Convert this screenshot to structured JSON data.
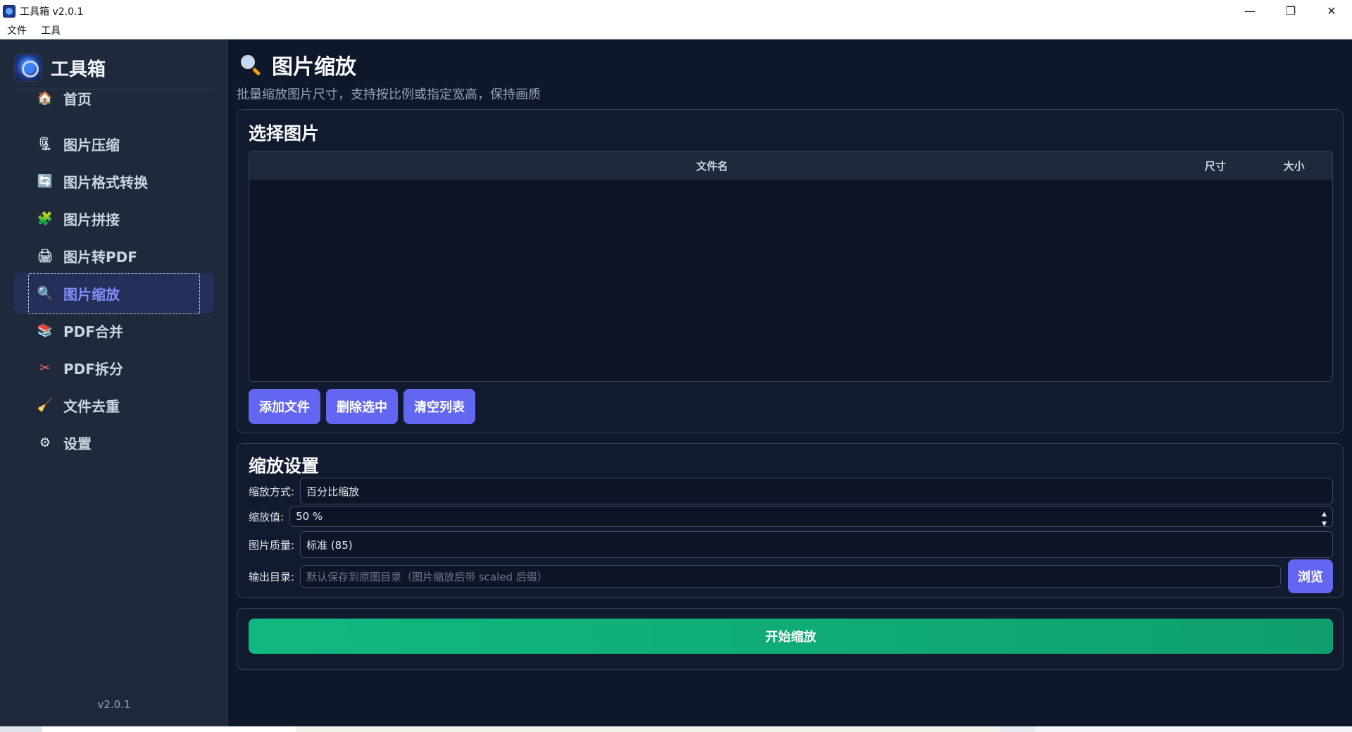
{
  "window": {
    "title": "工具箱 v2.0.1",
    "controls": {
      "minimize": "—",
      "restore": "❐",
      "close": "✕"
    }
  },
  "menu": [
    "文件",
    "工具"
  ],
  "sidebar": {
    "brand": "工具箱",
    "items": [
      {
        "label": "首页",
        "icon": "home-icon",
        "glyph": "🏠",
        "active": false
      },
      {
        "label": "图片压缩",
        "icon": "clamp-icon",
        "glyph": "🗜",
        "active": false
      },
      {
        "label": "图片格式转换",
        "icon": "convert-icon",
        "glyph": "🔄",
        "active": false
      },
      {
        "label": "图片拼接",
        "icon": "puzzle-icon",
        "glyph": "🧩",
        "active": false
      },
      {
        "label": "图片转PDF",
        "icon": "printer-icon",
        "glyph": "🖨",
        "active": false
      },
      {
        "label": "图片缩放",
        "icon": "magnifier-icon",
        "glyph": "🔍",
        "active": true
      },
      {
        "label": "PDF合并",
        "icon": "stack-icon",
        "glyph": "📚",
        "active": false
      },
      {
        "label": "PDF拆分",
        "icon": "scissors-icon",
        "glyph": "✂",
        "active": false
      },
      {
        "label": "文件去重",
        "icon": "broom-icon",
        "glyph": "🧹",
        "active": false
      },
      {
        "label": "设置",
        "icon": "gear-icon",
        "glyph": "⚙",
        "active": false
      }
    ],
    "version": "v2.0.1"
  },
  "page": {
    "title": "图片缩放",
    "subtitle": "批量缩放图片尺寸，支持按比例或指定宽高，保持画质"
  },
  "select": {
    "title": "选择图片",
    "columns": {
      "name": "文件名",
      "size": "尺寸",
      "bytes": "大小"
    },
    "rows": [],
    "buttons": {
      "add": "添加文件",
      "remove": "删除选中",
      "clear": "清空列表"
    }
  },
  "settings": {
    "title": "缩放设置",
    "mode_label": "缩放方式:",
    "mode_value": "百分比缩放",
    "value_label": "缩放值:",
    "value_value": "50 %",
    "quality_label": "图片质量:",
    "quality_value": "标准 (85)",
    "output_label": "输出目录:",
    "output_placeholder": "默认保存到原图目录（图片缩放后带   scaled 后缀）",
    "browse": "浏览"
  },
  "start": {
    "label": "开始缩放"
  },
  "colors": {
    "accent": "#6366f1",
    "start": "#10b981",
    "background": "#0f172a",
    "sidebar": "#1e293b"
  }
}
